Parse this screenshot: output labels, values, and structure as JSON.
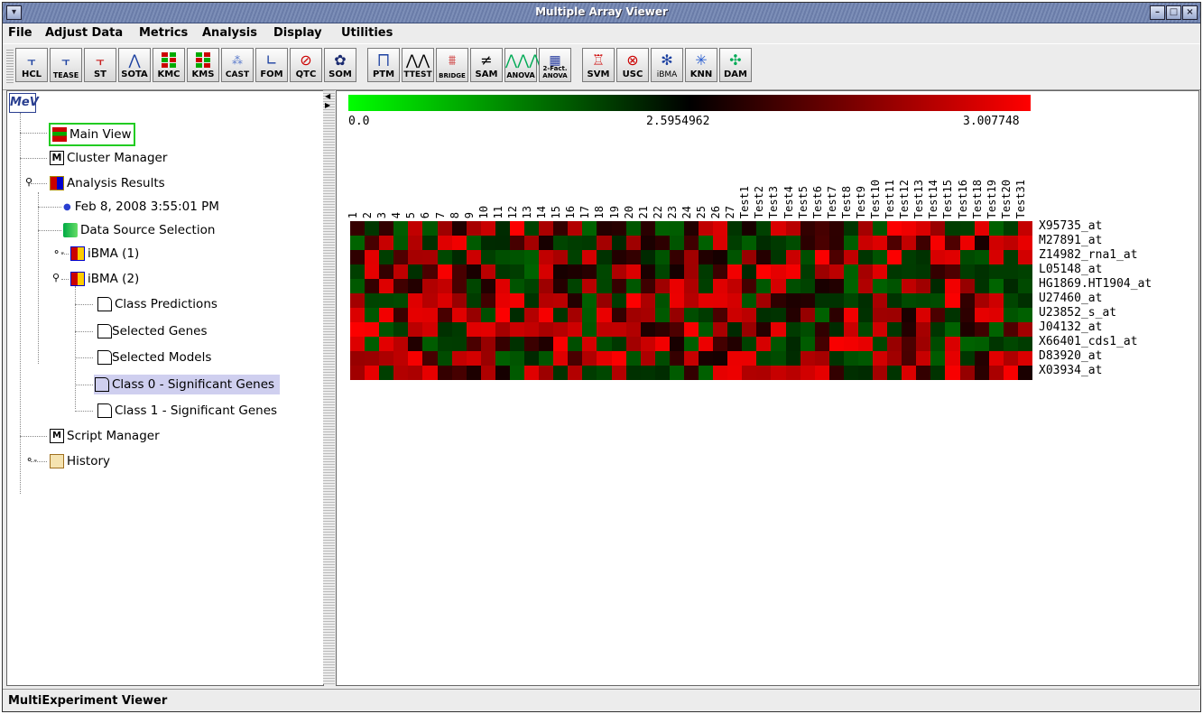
{
  "window": {
    "title": "Multiple Array Viewer",
    "controls": [
      "minimize-icon",
      "maximize-icon",
      "close-icon"
    ]
  },
  "menu": [
    "File",
    "Adjust Data",
    "Metrics",
    "Analysis",
    "Display",
    "Utilities"
  ],
  "toolbar": [
    {
      "label": "HCL",
      "icon": "hcl-tree-icon"
    },
    {
      "label": "TEASE",
      "icon": "tease-tree-icon"
    },
    {
      "label": "ST",
      "icon": "st-tree-icon"
    },
    {
      "label": "SOTA",
      "icon": "sota-icon"
    },
    {
      "label": "KMC",
      "icon": "kmc-icon"
    },
    {
      "label": "KMS",
      "icon": "kms-icon"
    },
    {
      "label": "CAST",
      "icon": "cast-icon"
    },
    {
      "label": "FOM",
      "icon": "fom-icon"
    },
    {
      "label": "QTC",
      "icon": "qtc-icon"
    },
    {
      "label": "SOM",
      "icon": "som-icon"
    },
    {
      "label": "PTM",
      "icon": "ptm-icon"
    },
    {
      "label": "TTEST",
      "icon": "ttest-icon"
    },
    {
      "label": "BRIDGE",
      "icon": "bridge-icon"
    },
    {
      "label": "SAM",
      "icon": "sam-icon"
    },
    {
      "label": "ANOVA",
      "icon": "anova-icon"
    },
    {
      "label": "2-Fact. ANOVA",
      "icon": "two-factor-anova-icon"
    },
    {
      "label": "SVM",
      "icon": "svm-icon"
    },
    {
      "label": "USC",
      "icon": "usc-icon"
    },
    {
      "label": "iBMA",
      "icon": "ibma-icon"
    },
    {
      "label": "KNN",
      "icon": "knn-icon"
    },
    {
      "label": "DAM",
      "icon": "dam-icon"
    }
  ],
  "tree": {
    "logo": "MeV",
    "main_view": "Main View",
    "cluster_manager": "Cluster Manager",
    "analysis_results": "Analysis Results",
    "timestamp": "Feb 8, 2008 3:55:01 PM",
    "data_source": "Data Source Selection",
    "ibma1": "iBMA (1)",
    "ibma2": "iBMA (2)",
    "class_predictions": "Class Predictions",
    "selected_genes": "Selected Genes",
    "selected_models": "Selected Models",
    "class0": "Class 0 - Significant Genes",
    "class1": "Class 1 - Significant Genes",
    "script_manager": "Script Manager",
    "history": "History"
  },
  "colorbar": {
    "min": "0.0",
    "mid": "2.5954962",
    "max": "3.007748",
    "colors": [
      "#00ff00",
      "#000000",
      "#ff0000"
    ]
  },
  "columns": [
    "1",
    "2",
    "3",
    "4",
    "5",
    "6",
    "7",
    "8",
    "9",
    "10",
    "11",
    "12",
    "13",
    "14",
    "15",
    "16",
    "17",
    "18",
    "19",
    "20",
    "21",
    "22",
    "23",
    "24",
    "25",
    "26",
    "27",
    "Test1",
    "Test2",
    "Test3",
    "Test4",
    "Test5",
    "Test6",
    "Test7",
    "Test8",
    "Test9",
    "Test10",
    "Test11",
    "Test12",
    "Test13",
    "Test14",
    "Test15",
    "Test16",
    "Test18",
    "Test19",
    "Test20",
    "Test31"
  ],
  "rows": [
    "X95735_at",
    "M27891_at",
    "Z14982_rna1_at",
    "L05148_at",
    "HG1869.HT1904_at",
    "U27460_at",
    "U23852_s_at",
    "J04132_at",
    "X66401_cds1_at",
    "D83920_at",
    "X03934_at"
  ],
  "status": "MultiExperiment Viewer"
}
